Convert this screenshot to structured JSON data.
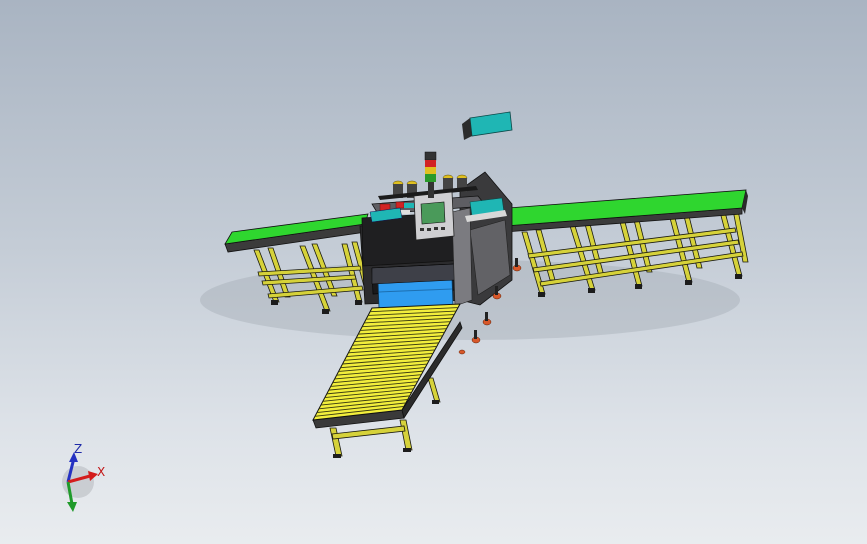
{
  "view": {
    "background_top": "#a9b4c2",
    "background_bottom": "#e9ecef"
  },
  "colors": {
    "conveyor_belt": "#2fd62f",
    "frame_yellow": "#d6d23a",
    "roller_yellow": "#f2ee3c",
    "machine_body": "#2b2b2d",
    "panel_blue": "#2f9cf0",
    "screen_teal": "#1fb6b4",
    "hmi_screen": "#4a9a5a",
    "foot_orange": "#d8582a",
    "signal_red": "#d22323",
    "signal_yellow": "#e0c020",
    "signal_green": "#2a9a2a"
  },
  "triad": {
    "x_label": "X",
    "y_label": "",
    "z_label": "Z",
    "x_color": "#d41c1c",
    "y_color": "#1f9a2a",
    "z_color": "#2431c2"
  }
}
